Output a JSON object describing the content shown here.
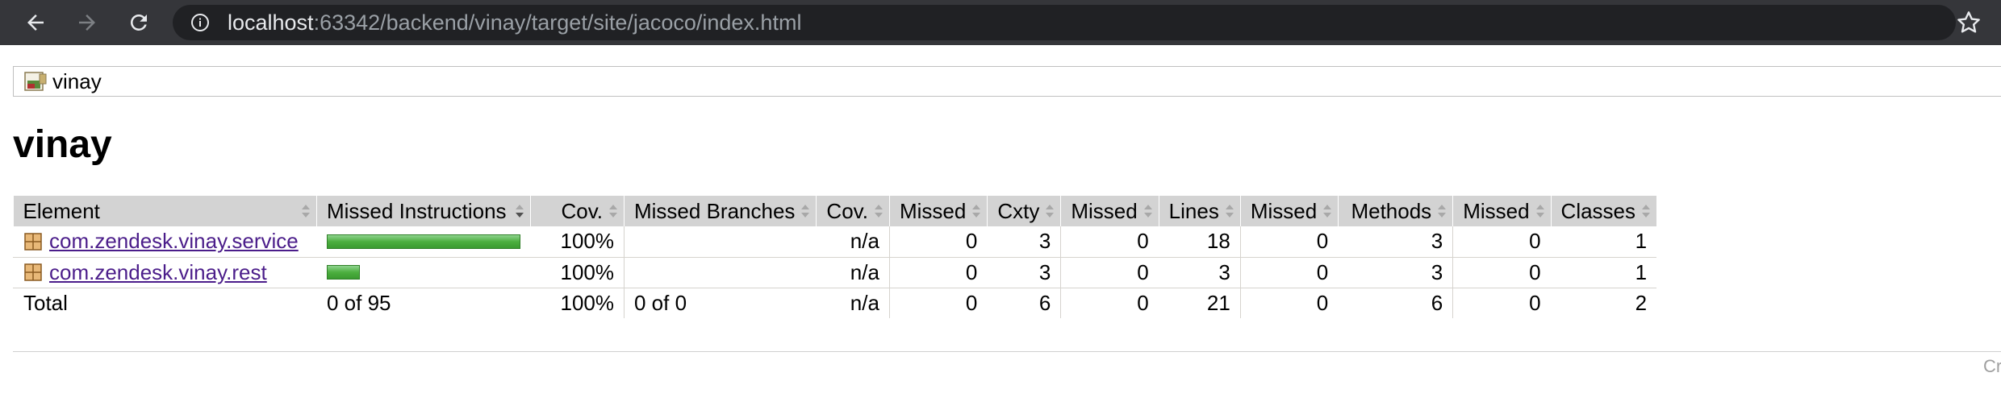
{
  "browser": {
    "url_host": "localhost",
    "url_path": ":63342/backend/vinay/target/site/jacoco/index.html",
    "icons": [
      "back-arrow-icon",
      "forward-arrow-icon",
      "reload-icon",
      "info-icon",
      "star-icon"
    ]
  },
  "breadcrumb": {
    "label": "vinay",
    "icon": "report-icon"
  },
  "page": {
    "title": "vinay"
  },
  "table": {
    "headers": {
      "element": "Element",
      "missed_instructions": "Missed Instructions",
      "cov1": "Cov.",
      "missed_branches": "Missed Branches",
      "cov2": "Cov.",
      "missed_cxty": "Missed",
      "cxty": "Cxty",
      "missed_lines": "Missed",
      "lines": "Lines",
      "missed_methods": "Missed",
      "methods": "Methods",
      "missed_classes": "Missed",
      "classes": "Classes"
    },
    "rows": [
      {
        "element": "com.zendesk.vinay.service",
        "instr_coverage_fraction": 1.0,
        "instr_bar_relative": 1.0,
        "cov1": "100%",
        "branches": "",
        "cov2": "n/a",
        "missed_cxty": "0",
        "cxty": "3",
        "missed_lines": "0",
        "lines": "18",
        "missed_methods": "0",
        "methods": "3",
        "missed_classes": "0",
        "classes": "1"
      },
      {
        "element": "com.zendesk.vinay.rest",
        "instr_coverage_fraction": 1.0,
        "instr_bar_relative": 0.17,
        "cov1": "100%",
        "branches": "",
        "cov2": "n/a",
        "missed_cxty": "0",
        "cxty": "3",
        "missed_lines": "0",
        "lines": "3",
        "missed_methods": "0",
        "methods": "3",
        "missed_classes": "0",
        "classes": "1"
      }
    ],
    "total": {
      "label": "Total",
      "instructions": "0 of 95",
      "cov1": "100%",
      "branches": "0 of 0",
      "cov2": "n/a",
      "missed_cxty": "0",
      "cxty": "6",
      "missed_lines": "0",
      "lines": "21",
      "missed_methods": "0",
      "methods": "6",
      "missed_classes": "0",
      "classes": "2"
    }
  },
  "footer": {
    "text": "Cr"
  },
  "colors": {
    "bar_green": "#4caf3f",
    "header_bg": "#d3d3d3",
    "link": "#4b1d8a"
  }
}
